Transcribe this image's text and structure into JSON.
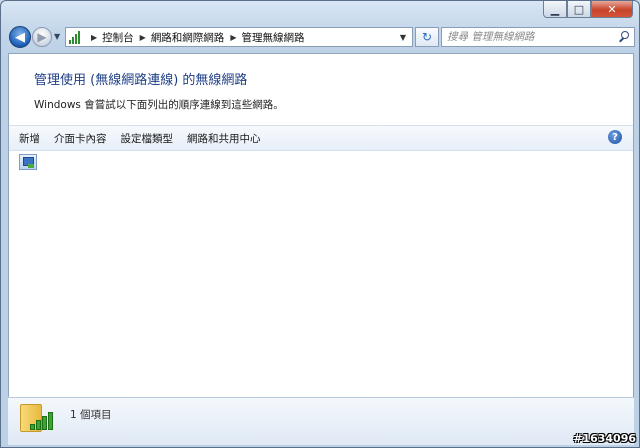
{
  "window": {
    "caption_buttons": {
      "minimize": "▁",
      "maximize": "□",
      "close": "✕"
    }
  },
  "navigation": {
    "back_glyph": "◀",
    "forward_glyph": "▶",
    "breadcrumbs": [
      "控制台",
      "網路和網際網路",
      "管理無線網路"
    ],
    "refresh_glyph": "↻"
  },
  "search": {
    "placeholder": "搜尋 管理無線網路"
  },
  "header": {
    "title": "管理使用 (無線網路連線) 的無線網路",
    "description": "Windows 會嘗試以下面列出的順序連線到這些網路。"
  },
  "toolbar": {
    "items": [
      "新增",
      "介面卡內容",
      "設定檔類型",
      "網路和共用中心"
    ],
    "help_glyph": "?"
  },
  "details": {
    "item_count": "1 個項目"
  },
  "watermark": "#1634096",
  "colors": {
    "title_blue": "#1e3f87",
    "accent": "#2b6cc0",
    "close_red": "#c8442c"
  }
}
